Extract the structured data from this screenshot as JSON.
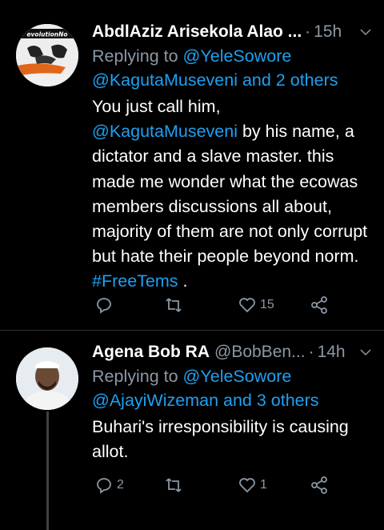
{
  "tweets": [
    {
      "author": "AbdlAziz Arisekola Alao ...",
      "handle": "",
      "time": "15h",
      "replying_prefix": "Replying to ",
      "replying_to": "@YeleSowore",
      "replying_line2": "@KagutaMuseveni and 2 others",
      "body_line1": "You just call him,",
      "mention": "@KagutaMuseveni",
      "body_after_mention": " by his name, a",
      "body_rest": "dictator and a slave master.  this made me wonder what the ecowas members discussions all about, majority of them are not only corrupt but hate their people beyond norm.",
      "hashtag": "#FreeTems",
      "body_end": " .",
      "avatar_text": "evolutionNo",
      "replies": "",
      "retweets": "",
      "likes": "15"
    },
    {
      "author": "Agena Bob RA",
      "handle": "@BobBen...",
      "time": "14h",
      "replying_prefix": "Replying to ",
      "replying_to": "@YeleSowore",
      "replying_line2": "@AjayiWizeman and 3 others",
      "body": "Buhari's irresponsibility is causing allot.",
      "replies": "2",
      "retweets": "",
      "likes": "1"
    }
  ],
  "icons": [
    "reply-icon",
    "retweet-icon",
    "like-icon",
    "share-icon",
    "chevron-down-icon"
  ],
  "colors": {
    "background": "#000000",
    "link": "#1da1f2",
    "muted": "#8b98a5"
  }
}
